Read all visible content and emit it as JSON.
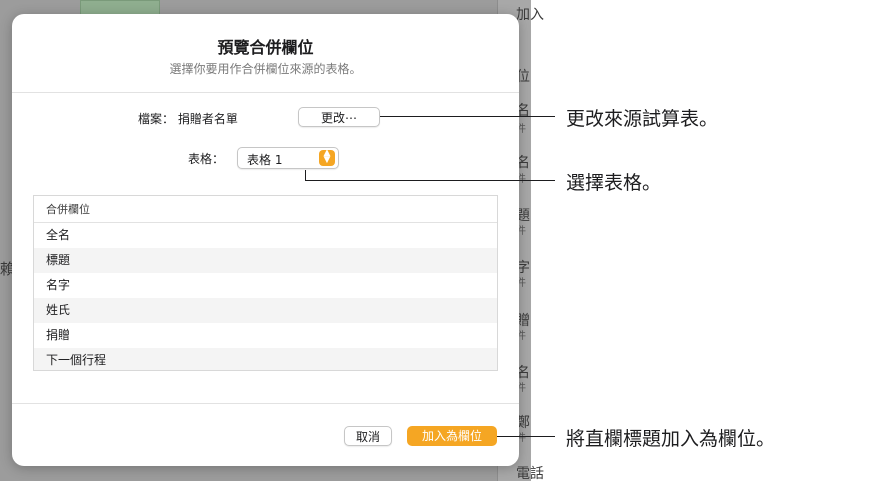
{
  "background": {
    "left_char": "賴",
    "right_items": [
      {
        "text": "加入",
        "sub": ""
      },
      {
        "text": "位",
        "sub": ""
      },
      {
        "text": "名",
        "sub": "件"
      },
      {
        "text": "名",
        "sub": "件"
      },
      {
        "text": "題",
        "sub": "件"
      },
      {
        "text": "字",
        "sub": "件"
      },
      {
        "text": "贈",
        "sub": "件"
      },
      {
        "text": "名",
        "sub": "件"
      },
      {
        "text": "鄭",
        "sub": "件"
      },
      {
        "text": "電話",
        "sub": ""
      }
    ]
  },
  "dialog": {
    "title": "預覽合併欄位",
    "subtitle": "選擇你要用作合併欄位來源的表格。",
    "file_label": "檔案：  捐贈者名單",
    "change_button": "更改⋯",
    "table_label": "表格：",
    "table_select": {
      "value": "表格 1",
      "up_arrow": "▲",
      "down_arrow": "▼"
    },
    "fields_header": "合併欄位",
    "fields": [
      "全名",
      "標題",
      "名字",
      "姓氏",
      "捐贈",
      "下一個行程"
    ],
    "cancel_button": "取消",
    "add_button": "加入為欄位"
  },
  "callouts": {
    "change_source": "更改來源試算表。",
    "choose_table": "選擇表格。",
    "add_headers": "將直欄標題加入為欄位。"
  },
  "colors": {
    "accent": "#f5a623",
    "dim_background": "#9c9c9c"
  }
}
